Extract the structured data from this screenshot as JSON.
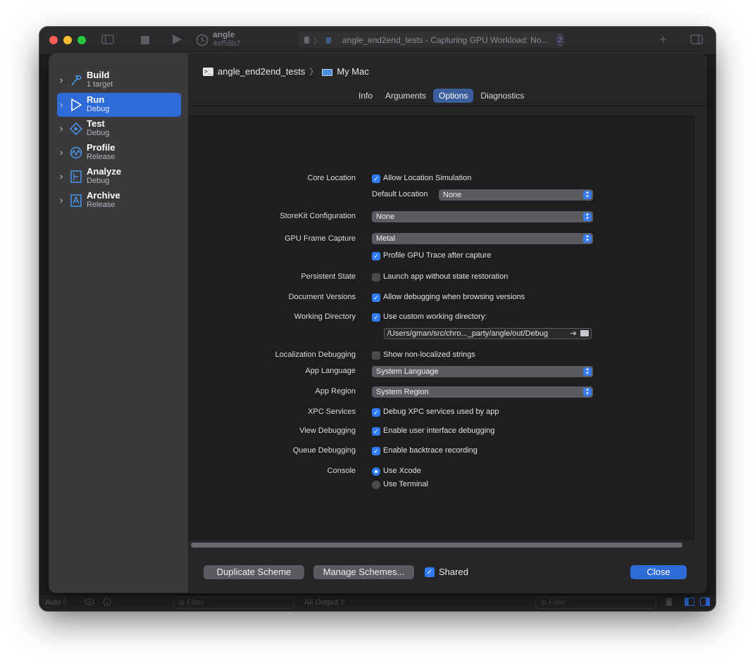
{
  "window": {
    "project_name": "angle",
    "project_commit": "4ef58b7",
    "activity_text": "angle_end2end_tests - Capturing GPU Workload: No...",
    "activity_badge": "2"
  },
  "statusbar": {
    "auto_label": "Auto ◊",
    "filter_left": "Filter",
    "output_select": "All Output ◊",
    "filter_right": "Filter"
  },
  "sidebar": {
    "actions": [
      {
        "name": "Build",
        "sub": "1 target",
        "icon": "hammer-icon"
      },
      {
        "name": "Run",
        "sub": "Debug",
        "icon": "play-icon"
      },
      {
        "name": "Test",
        "sub": "Debug",
        "icon": "test-diamond-icon"
      },
      {
        "name": "Profile",
        "sub": "Release",
        "icon": "profile-gauge-icon"
      },
      {
        "name": "Analyze",
        "sub": "Debug",
        "icon": "analyze-icon"
      },
      {
        "name": "Archive",
        "sub": "Release",
        "icon": "archive-icon"
      }
    ]
  },
  "breadcrumb": {
    "scheme": "angle_end2end_tests",
    "destination": "My Mac"
  },
  "tabs": [
    "Info",
    "Arguments",
    "Options",
    "Diagnostics"
  ],
  "options": {
    "core_location_label": "Core Location",
    "allow_location_sim": "Allow Location Simulation",
    "default_location_label": "Default Location",
    "default_location_value": "None",
    "storekit_label": "StoreKit Configuration",
    "storekit_value": "None",
    "gpu_frame_label": "GPU Frame Capture",
    "gpu_frame_value": "Metal",
    "profile_gpu_trace": "Profile GPU Trace after capture",
    "persistent_state_label": "Persistent State",
    "launch_without_state": "Launch app without state restoration",
    "document_versions_label": "Document Versions",
    "allow_debug_versions": "Allow debugging when browsing versions",
    "working_dir_label": "Working Directory",
    "use_custom_working_dir": "Use custom working directory:",
    "working_dir_path": "/Users/gman/src/chro..._party/angle/out/Debug",
    "localization_label": "Localization Debugging",
    "show_non_localized": "Show non-localized strings",
    "app_language_label": "App Language",
    "app_language_value": "System Language",
    "app_region_label": "App Region",
    "app_region_value": "System Region",
    "xpc_label": "XPC Services",
    "debug_xpc": "Debug XPC services used by app",
    "view_debugging_label": "View Debugging",
    "enable_ui_debugging": "Enable user interface debugging",
    "queue_debugging_label": "Queue Debugging",
    "enable_backtrace": "Enable backtrace recording",
    "console_label": "Console",
    "use_xcode": "Use Xcode",
    "use_terminal": "Use Terminal"
  },
  "footer": {
    "duplicate": "Duplicate Scheme",
    "manage": "Manage Schemes...",
    "shared": "Shared",
    "close": "Close"
  },
  "colors": {
    "accent": "#2f6bd6",
    "checkbox_on": "#2f7cf5"
  }
}
